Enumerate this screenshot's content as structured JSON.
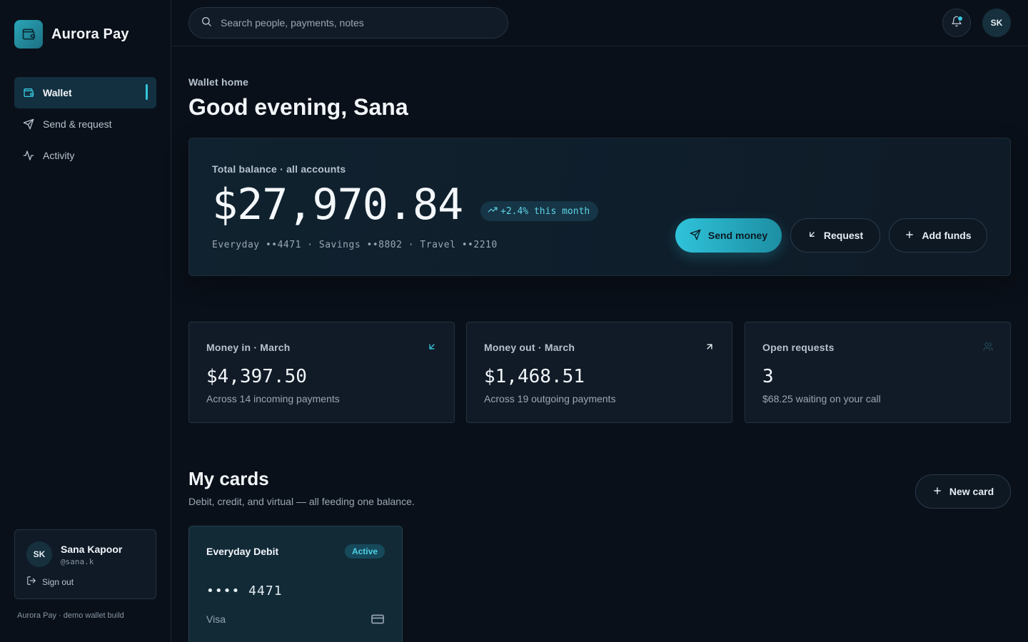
{
  "app": {
    "name": "Aurora Pay",
    "logo_icon": "wallet-icon",
    "accent": "#35c6db"
  },
  "sidebar": {
    "items": [
      {
        "label": "Wallet",
        "icon": "wallet-icon",
        "active": true
      },
      {
        "label": "Send & request",
        "icon": "send-icon",
        "active": false
      },
      {
        "label": "Activity",
        "icon": "activity-icon",
        "active": false
      }
    ],
    "user": {
      "initials": "SK",
      "name": "Sana Kapoor",
      "handle": "@sana.k",
      "sign_out": "Sign out"
    },
    "footer": "Aurora Pay · demo wallet build"
  },
  "topbar": {
    "search_placeholder": "Search people, payments, notes",
    "avatar_initials": "SK",
    "has_notification": true
  },
  "header": {
    "eyebrow": "Wallet home",
    "greeting": "Good evening, Sana"
  },
  "balance": {
    "label": "Total balance · all accounts",
    "amount": "$27,970.84",
    "trend": "+2.4% this month",
    "accounts": "Everyday ••4471 · Savings ••8802 · Travel ••2210",
    "actions": {
      "send": "Send money",
      "request": "Request",
      "add": "Add funds"
    }
  },
  "stats": [
    {
      "label": "Money in · March",
      "value": "$4,397.50",
      "sub": "Across 14 incoming payments",
      "icon": "arrow-down-left-icon"
    },
    {
      "label": "Money out · March",
      "value": "$1,468.51",
      "sub": "Across 19 outgoing payments",
      "icon": "arrow-up-right-icon"
    },
    {
      "label": "Open requests",
      "value": "3",
      "sub": "$68.25 waiting on your call",
      "icon": "users-icon"
    }
  ],
  "cards_section": {
    "title": "My cards",
    "subtitle": "Debit, credit, and virtual — all feeding one balance.",
    "new_card": "New card",
    "cards": [
      {
        "name": "Everyday Debit",
        "status": "Active",
        "number": "•••• 4471",
        "network": "Visa",
        "icon": "credit-card-icon"
      }
    ]
  }
}
